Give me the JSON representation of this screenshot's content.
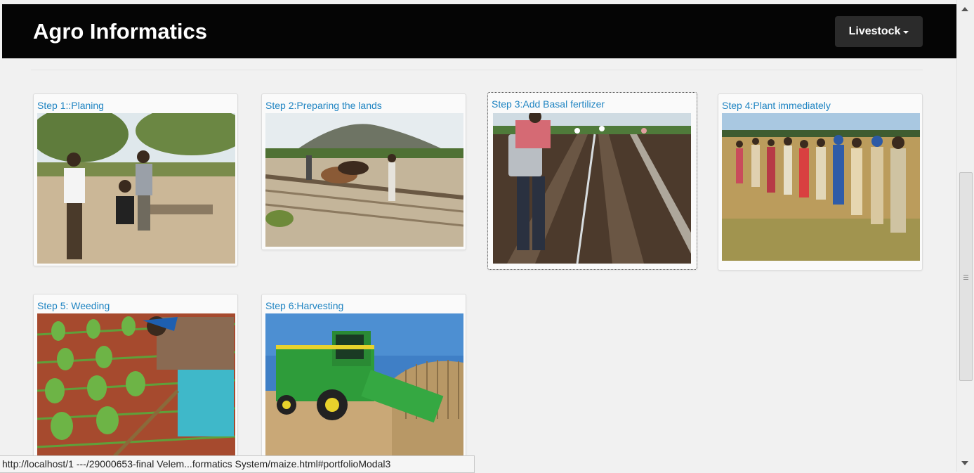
{
  "navbar": {
    "brand": "Agro Informatics",
    "dropdown_label": "Livestock"
  },
  "steps": [
    {
      "title": "Step 1::Planing",
      "image": "farmers-discussion-photo"
    },
    {
      "title": "Step 2:Preparing the lands",
      "image": "oxen-plowing-photo"
    },
    {
      "title": "Step 3:Add Basal fertilizer",
      "image": "fertilizer-spraying-photo"
    },
    {
      "title": "Step 4:Plant immediately",
      "image": "planting-line-photo"
    },
    {
      "title": "Step 5: Weeding",
      "image": "weeding-photo"
    },
    {
      "title": "Step 6:Harvesting",
      "image": "combine-harvester-photo"
    }
  ],
  "status_bar": {
    "url": "http://localhost/1 ---/29000653-final Velem...formatics System/maize.html#portfolioModal3"
  },
  "colors": {
    "navbar_bg": "#050505",
    "link": "#1f84c2",
    "page_bg": "#f1f1f1"
  }
}
